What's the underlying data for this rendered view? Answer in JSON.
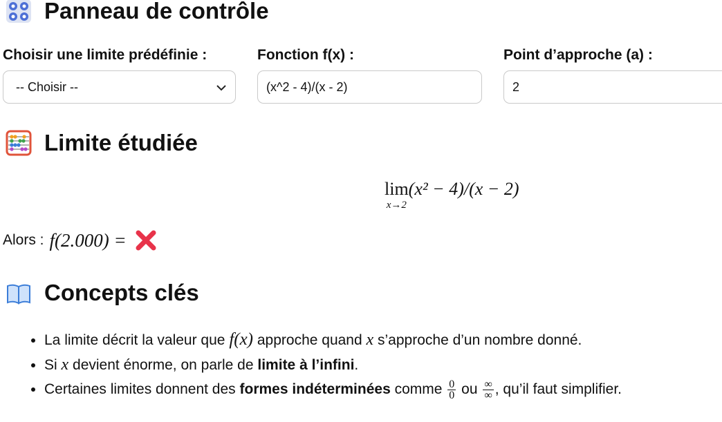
{
  "control_panel": {
    "title": "Panneau de contrôle",
    "preset_label": "Choisir une limite prédéfinie :",
    "preset_value": "-- Choisir --",
    "function_label": "Fonction f(x) :",
    "function_value": "(x^2 - 4)/(x - 2)",
    "point_label": "Point d’approche (a) :",
    "point_value": "2"
  },
  "limit_section": {
    "title": "Limite étudiée",
    "lim_word": "lim",
    "lim_sub": "x→2",
    "expression": "(x² − 4)/(x − 2)",
    "then_label": "Alors :",
    "evaluation": "f(2.000) =",
    "result_symbol": "❌"
  },
  "concepts": {
    "title": "Concepts clés",
    "item1_a": "La limite décrit la valeur que",
    "item1_fx": "f(x)",
    "item1_b": "approche quand",
    "item1_x": "x",
    "item1_c": "s’approche d’un nombre donné.",
    "item2_a": "Si",
    "item2_x": "x",
    "item2_b": "devient énorme, on parle de",
    "item2_bold": "limite à l’infini",
    "item2_c": ".",
    "item3_a": "Certaines limites donnent des",
    "item3_bold": "formes indéterminées",
    "item3_b": "comme",
    "frac1_num": "0",
    "frac1_den": "0",
    "item3_or": "ou",
    "frac2_num": "∞",
    "frac2_den": "∞",
    "item3_c": ", qu’il faut simplifier."
  },
  "icons": [
    "control-knobs-icon",
    "abacus-icon",
    "open-book-icon",
    "cross-mark-icon",
    "chevron-down-icon"
  ],
  "colors": {
    "text": "#111111",
    "border": "#c9c9c9",
    "cross": "#e8334a"
  }
}
